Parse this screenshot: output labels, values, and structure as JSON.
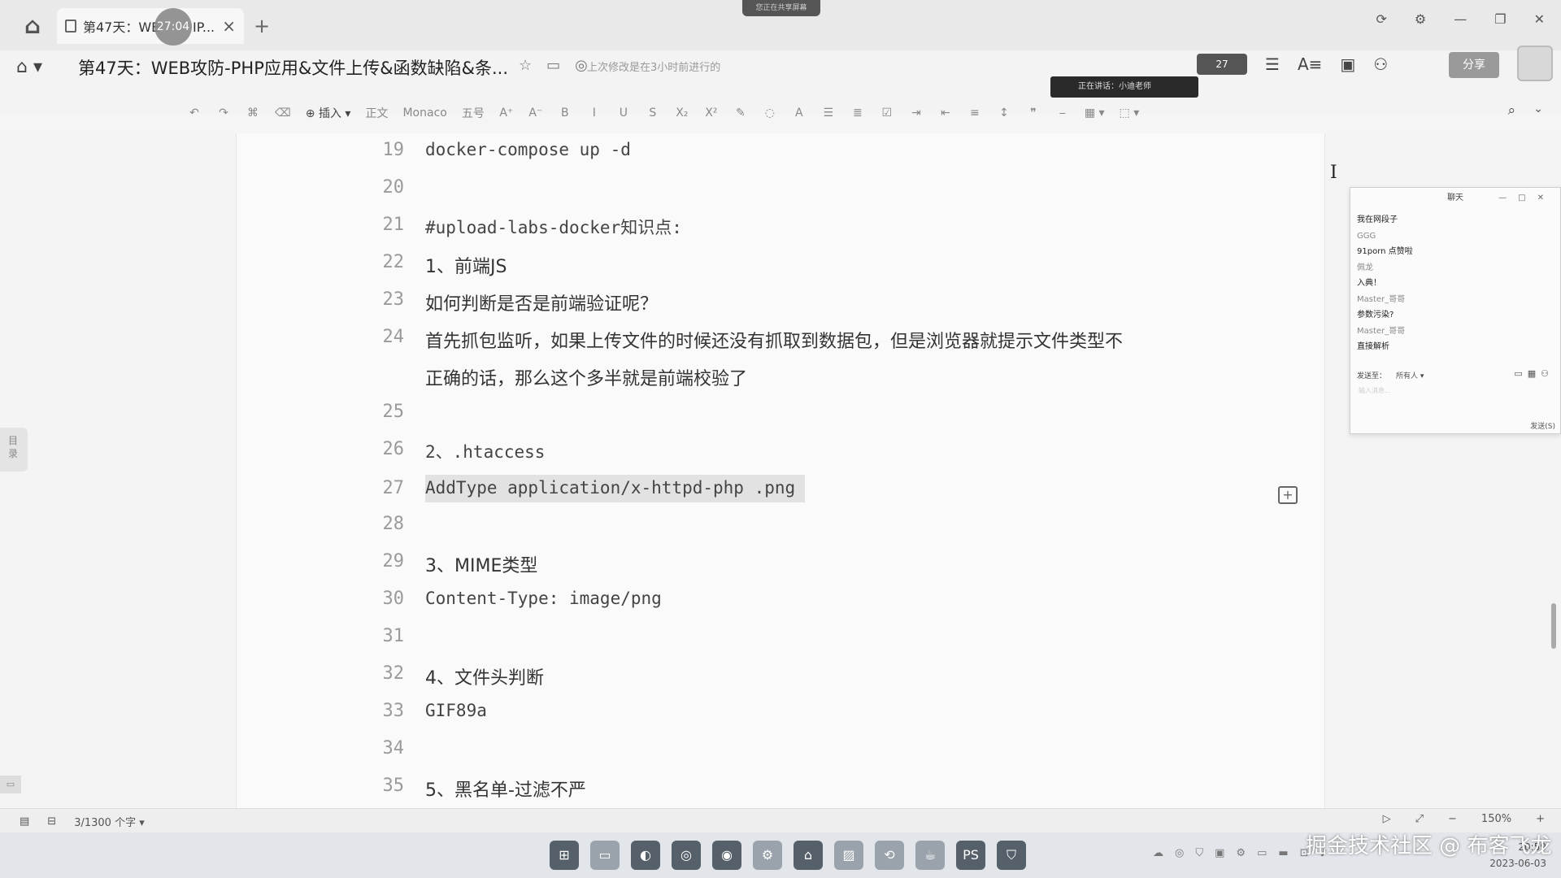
{
  "tabbar": {
    "tab_title": "第47天：WE",
    "tab_title_tail": "IP...",
    "timer": "27:04",
    "notice": "您正在共享屏幕"
  },
  "header": {
    "doc_title": "第47天：WEB攻防-PHP应用&文件上传&函数缺陷&条...",
    "save_status": "上次修改是在3小时前进行的",
    "talking": "正在讲话：小迪老师",
    "avatar_count": "27",
    "share_label": "分享"
  },
  "toolbar": {
    "insert_label": "插入",
    "style_label": "正文",
    "font_label": "Monaco",
    "size_label": "五号"
  },
  "lines": [
    {
      "num": "19",
      "text": "docker-compose up -d"
    },
    {
      "num": "20",
      "text": ""
    },
    {
      "num": "21",
      "text": "#upload-labs-docker知识点:"
    },
    {
      "num": "22",
      "text": "1、前端JS"
    },
    {
      "num": "23",
      "text": "如何判断是否是前端验证呢？"
    },
    {
      "num": "24",
      "text": "首先抓包监听，如果上传文件的时候还没有抓取到数据包，但是浏览器就提示文件类型不",
      "cont": "正确的话，那么这个多半就是前端校验了"
    },
    {
      "num": "25",
      "text": ""
    },
    {
      "num": "26",
      "text": "2、.htaccess"
    },
    {
      "num": "27",
      "text": "AddType application/x-httpd-php .png"
    },
    {
      "num": "28",
      "text": ""
    },
    {
      "num": "29",
      "text": "3、MIME类型"
    },
    {
      "num": "30",
      "text": "Content-Type: image/png"
    },
    {
      "num": "31",
      "text": ""
    },
    {
      "num": "32",
      "text": "4、文件头判断"
    },
    {
      "num": "33",
      "text": "GIF89a"
    },
    {
      "num": "34",
      "text": ""
    },
    {
      "num": "35",
      "text": "5、黑名单-过滤不严"
    }
  ],
  "toc_label": "目录",
  "chat": {
    "title": "聊天",
    "messages": [
      {
        "kind": "text",
        "text": "我在网段子"
      },
      {
        "kind": "name",
        "text": "GGG"
      },
      {
        "kind": "text",
        "text": "91porn 点赞啦"
      },
      {
        "kind": "name",
        "text": "佩龙"
      },
      {
        "kind": "text",
        "text": "入典！"
      },
      {
        "kind": "name",
        "text": "Master_哥哥"
      },
      {
        "kind": "text",
        "text": "参数污染?"
      },
      {
        "kind": "name",
        "text": "Master_哥哥"
      },
      {
        "kind": "text",
        "text": "直接解析"
      }
    ],
    "send_to_label": "发送至：",
    "send_to_value": "所有人",
    "input_hint": "输入消息...",
    "send_label": "发送(S)"
  },
  "statusbar": {
    "word_count": "3/1300 个字",
    "zoom": "150%"
  },
  "taskbar": {
    "time": "20:59",
    "date": "2023-06-03"
  },
  "watermark": "掘金技术社区 @ 布客飞龙"
}
